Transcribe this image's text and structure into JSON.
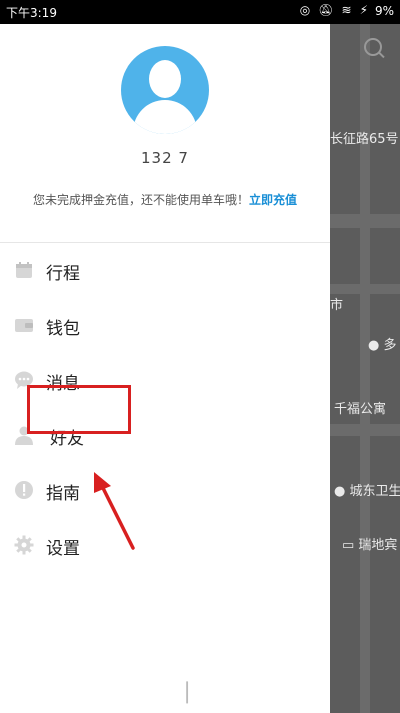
{
  "status_bar": {
    "time": "下午3:19",
    "battery": "9%"
  },
  "drawer": {
    "phone": "132         7",
    "notice_text": "您未完成押金充值，还不能使用单车哦！",
    "notice_link": "立即充值",
    "menu": [
      {
        "label": "行程",
        "icon": "calendar-icon"
      },
      {
        "label": "钱包",
        "icon": "wallet-icon"
      },
      {
        "label": "消息",
        "icon": "message-icon"
      },
      {
        "label": "好友",
        "icon": "friends-icon"
      },
      {
        "label": "指南",
        "icon": "guide-icon"
      },
      {
        "label": "设置",
        "icon": "gear-icon"
      }
    ]
  },
  "map": {
    "labels": [
      "长征路65号",
      "市",
      "多",
      "千福公寓",
      "城东卫生",
      "瑞地宾"
    ]
  },
  "colors": {
    "accent": "#1a8fd6",
    "avatar_bg": "#4fb3ea",
    "highlight": "#d82020",
    "map_overlay": "#5c5c5c"
  }
}
